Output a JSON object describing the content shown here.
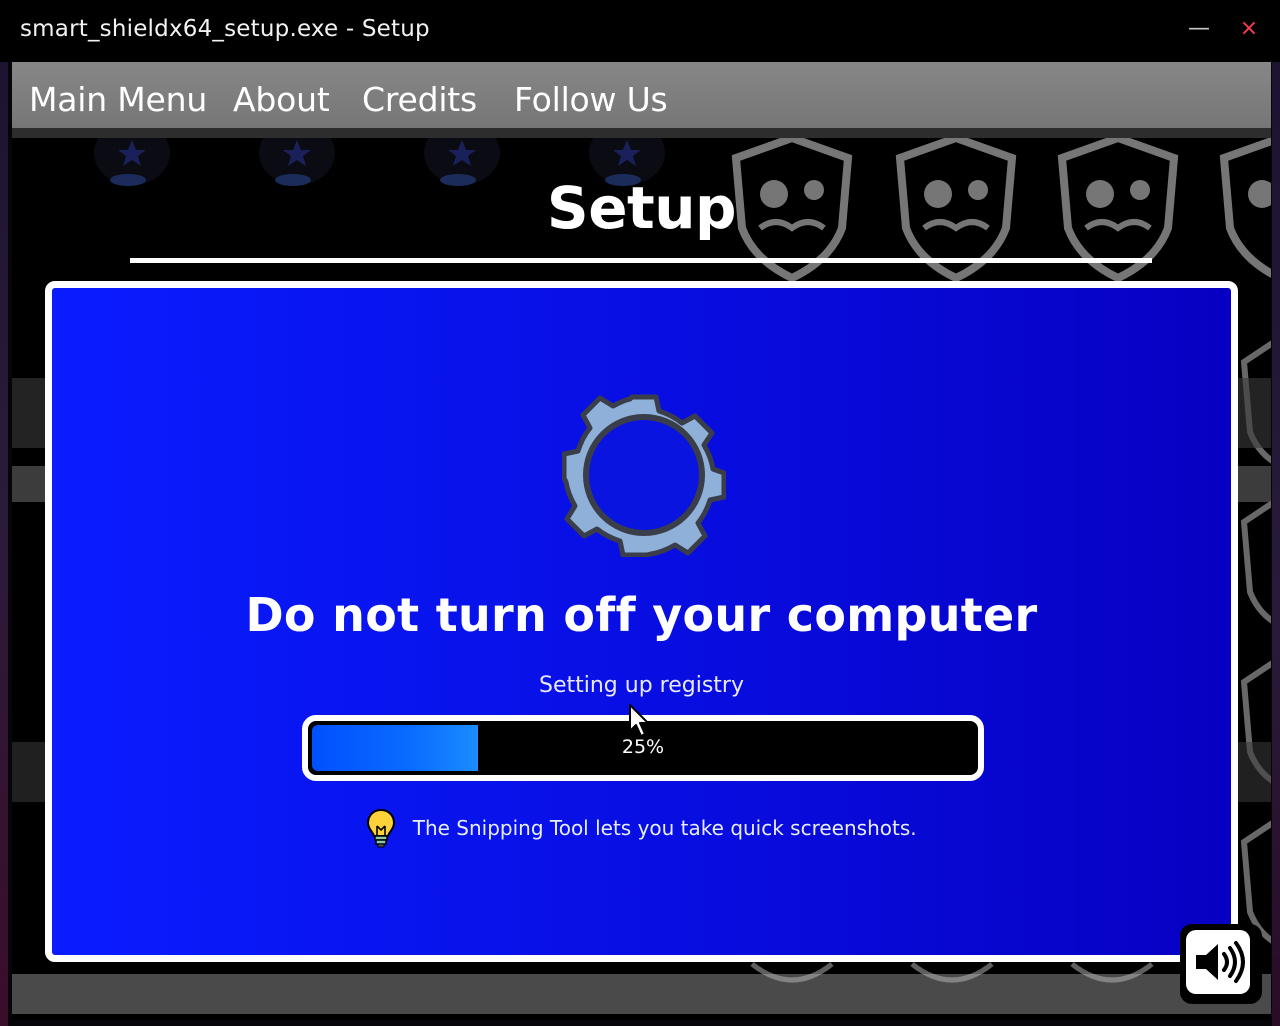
{
  "window": {
    "title": "smart_shieldx64_setup.exe - Setup",
    "minimize_glyph": "—",
    "close_glyph": "×"
  },
  "menu": {
    "items": [
      {
        "label": "Main Menu"
      },
      {
        "label": "About"
      },
      {
        "label": "Credits"
      },
      {
        "label": "Follow Us"
      }
    ]
  },
  "page": {
    "title": "Setup"
  },
  "panel": {
    "headline": "Do not turn off your computer",
    "status": "Setting up registry",
    "progress": {
      "percent_label": "25%",
      "value": 0.25
    },
    "tip": {
      "icon": "lightbulb-icon",
      "text": "The Snipping Tool lets you take quick screenshots."
    }
  },
  "icons": {
    "gear": "gear-icon",
    "sound": "speaker-icon"
  },
  "colors": {
    "panel_blue": "#0a1cff",
    "progress_fill": "#0a6cff",
    "close_red": "#ff3b52",
    "menubar_grey": "#808080"
  }
}
